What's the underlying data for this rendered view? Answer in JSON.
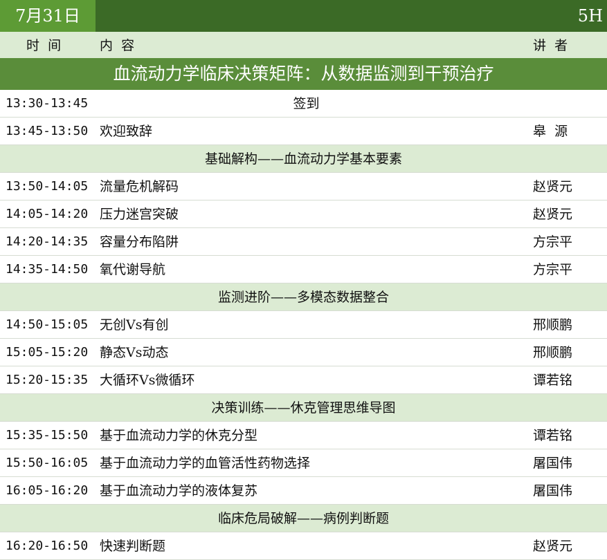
{
  "header": {
    "date": "7月31日",
    "hours": "5H"
  },
  "columns": {
    "time": "时  间",
    "content": "内  容",
    "speaker": "讲  者"
  },
  "title": "血流动力学临床决策矩阵：从数据监测到干预治疗",
  "rows": [
    {
      "kind": "item",
      "time": "13:30-13:45",
      "topic": "签到",
      "speaker": "",
      "centered": true
    },
    {
      "kind": "item",
      "time": "13:45-13:50",
      "topic": "欢迎致辞",
      "speaker": "皋  源"
    },
    {
      "kind": "section",
      "text": "基础解构——血流动力学基本要素"
    },
    {
      "kind": "item",
      "time": "13:50-14:05",
      "topic": "流量危机解码",
      "speaker": "赵贤元"
    },
    {
      "kind": "item",
      "time": "14:05-14:20",
      "topic": "压力迷宫突破",
      "speaker": "赵贤元"
    },
    {
      "kind": "item",
      "time": "14:20-14:35",
      "topic": "容量分布陷阱",
      "speaker": "方宗平"
    },
    {
      "kind": "item",
      "time": "14:35-14:50",
      "topic": "氧代谢导航",
      "speaker": "方宗平"
    },
    {
      "kind": "section",
      "text": "监测进阶——多模态数据整合"
    },
    {
      "kind": "item",
      "time": "14:50-15:05",
      "topic": "无创Vs有创",
      "speaker": "邢顺鹏"
    },
    {
      "kind": "item",
      "time": "15:05-15:20",
      "topic": "静态Vs动态",
      "speaker": "邢顺鹏"
    },
    {
      "kind": "item",
      "time": "15:20-15:35",
      "topic": "大循环Vs微循环",
      "speaker": "谭若铭"
    },
    {
      "kind": "section",
      "text": "决策训练——休克管理思维导图"
    },
    {
      "kind": "item",
      "time": "15:35-15:50",
      "topic": "基于血流动力学的休克分型",
      "speaker": "谭若铭"
    },
    {
      "kind": "item",
      "time": "15:50-16:05",
      "topic": "基于血流动力学的血管活性药物选择",
      "speaker": "屠国伟"
    },
    {
      "kind": "item",
      "time": "16:05-16:20",
      "topic": "基于血流动力学的液体复苏",
      "speaker": "屠国伟"
    },
    {
      "kind": "section",
      "text": "临床危局破解——病例判断题"
    },
    {
      "kind": "item",
      "time": "16:20-16:50",
      "topic": "快速判断题",
      "speaker": "赵贤元"
    }
  ]
}
